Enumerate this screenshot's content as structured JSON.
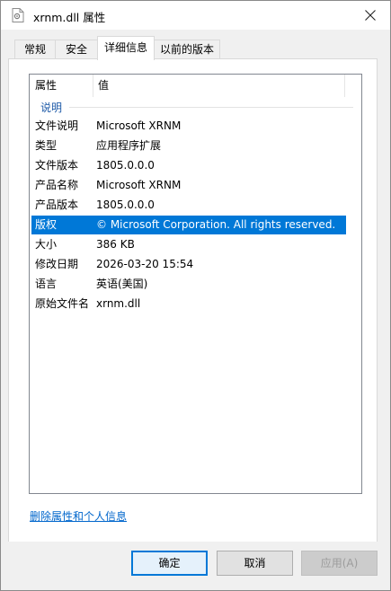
{
  "window": {
    "title": "xrnm.dll 属性",
    "close_label": "✕"
  },
  "tabs": [
    {
      "label": "常规"
    },
    {
      "label": "安全"
    },
    {
      "label": "详细信息"
    },
    {
      "label": "以前的版本"
    }
  ],
  "active_tab": "详细信息",
  "details": {
    "headers": {
      "name": "属性",
      "value": "值"
    },
    "group_label": "说明",
    "rows": [
      {
        "name": "文件说明",
        "value": "Microsoft XRNM"
      },
      {
        "name": "类型",
        "value": "应用程序扩展"
      },
      {
        "name": "文件版本",
        "value": "1805.0.0.0"
      },
      {
        "name": "产品名称",
        "value": "Microsoft XRNM"
      },
      {
        "name": "产品版本",
        "value": "1805.0.0.0"
      },
      {
        "name": "版权",
        "value": "© Microsoft Corporation. All rights reserved.",
        "selected": true
      },
      {
        "name": "大小",
        "value": "386 KB"
      },
      {
        "name": "修改日期",
        "value": "2026-03-20 15:54"
      },
      {
        "name": "语言",
        "value": "英语(美国)"
      },
      {
        "name": "原始文件名",
        "value": "xrnm.dll"
      }
    ]
  },
  "remove_link": "删除属性和个人信息",
  "buttons": {
    "ok": "确定",
    "cancel": "取消",
    "apply": "应用(A)"
  },
  "colors": {
    "selection": "#0078d7",
    "link": "#0066cc",
    "group_label": "#1e5aa8"
  }
}
